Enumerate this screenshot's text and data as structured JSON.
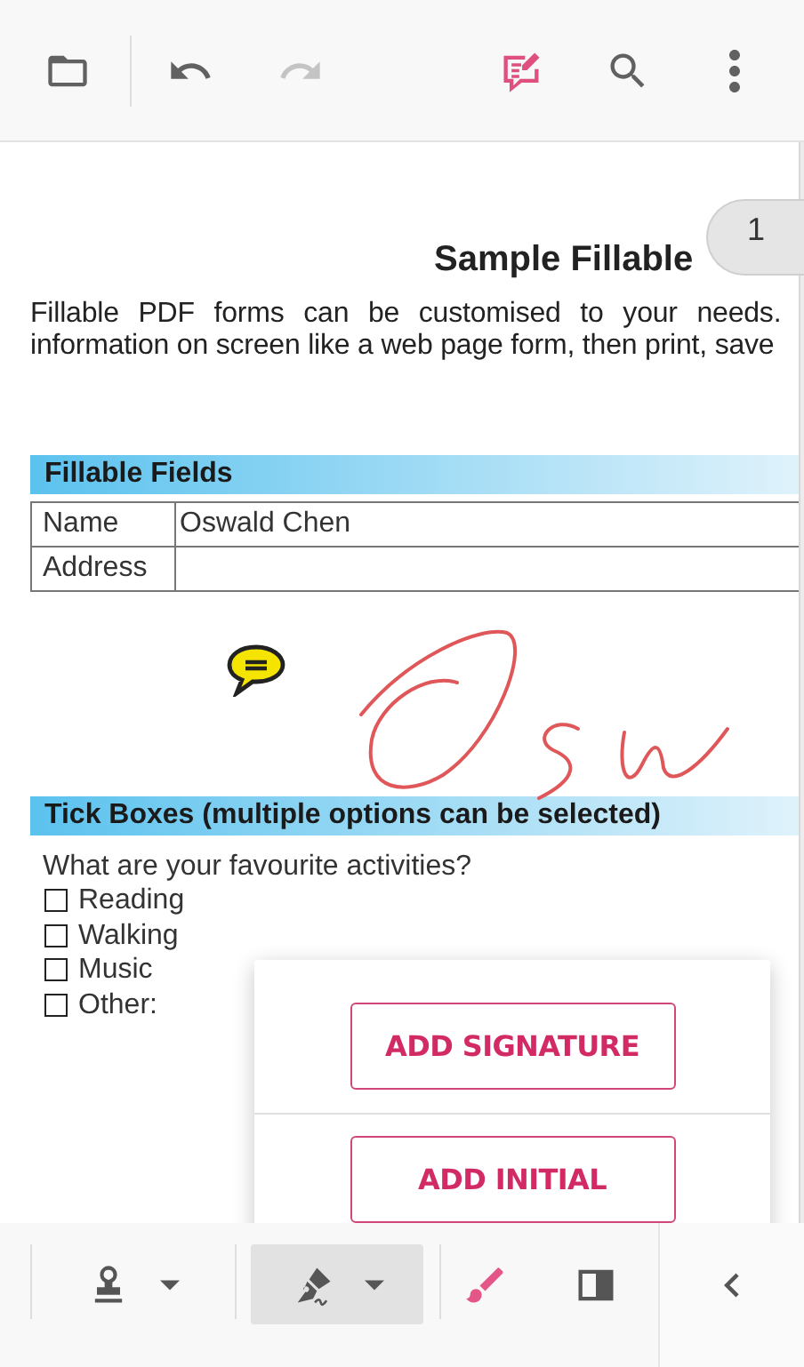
{
  "toolbar": {
    "left": [
      {
        "kind": "folder",
        "disabled": false,
        "active": false
      },
      {
        "kind": "undo",
        "disabled": false,
        "active": false
      },
      {
        "kind": "redo",
        "disabled": true,
        "active": false
      }
    ],
    "right": [
      {
        "kind": "annotate",
        "disabled": false,
        "active": true
      },
      {
        "kind": "search",
        "disabled": false,
        "active": false
      },
      {
        "kind": "more",
        "disabled": false,
        "active": false
      }
    ]
  },
  "page_badge": "1",
  "document": {
    "title": "Sample Fillable",
    "intro": [
      "Fillable PDF forms can be customised to your needs.",
      "information on screen like a web page form, then print, save"
    ],
    "sections": [
      {
        "kind": "fields",
        "heading": "Fillable Fields",
        "fields": [
          {
            "label": "Name",
            "value": "Oswald Chen"
          },
          {
            "label": "Address"
          }
        ]
      },
      {
        "kind": "annotations",
        "items": [
          {
            "kind": "note"
          },
          {
            "kind": "ink"
          }
        ]
      },
      {
        "kind": "checkboxes",
        "heading": "Tick Boxes (multiple options can be selected)",
        "question": "What are your favourite activities?",
        "options": [
          {
            "label": "Reading",
            "checked": false
          },
          {
            "label": "Walking",
            "checked": false
          },
          {
            "label": "Music",
            "checked": false
          },
          {
            "label": "Other:",
            "checked": false
          }
        ]
      }
    ]
  },
  "signature_menu": {
    "buttons": [
      "ADD SIGNATURE",
      "ADD INITIAL"
    ]
  },
  "bottom_toolbar": {
    "tools": [
      {
        "kind": "stamp",
        "dropdown": true,
        "selected": false
      },
      {
        "kind": "signature",
        "dropdown": true,
        "selected": true
      },
      {
        "kind": "brush",
        "dropdown": false,
        "selected": false
      },
      {
        "kind": "panel",
        "dropdown": false,
        "selected": false
      }
    ]
  }
}
